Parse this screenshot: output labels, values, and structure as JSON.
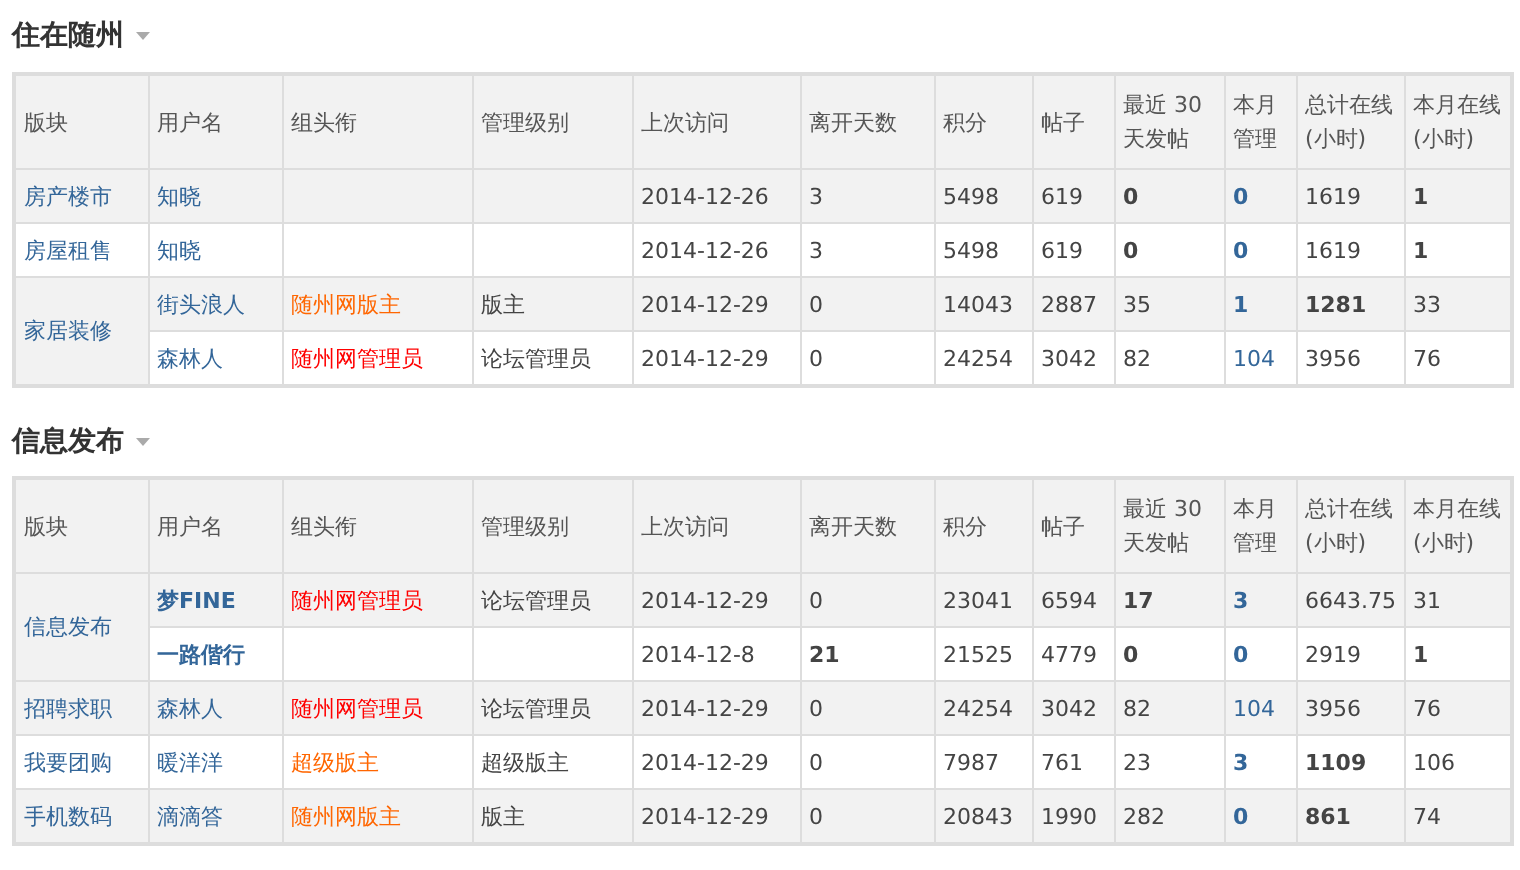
{
  "sections": [
    {
      "title": "住在随州",
      "columns": [
        "版块",
        "用户名",
        "组头衔",
        "管理级别",
        "上次访问",
        "离开天数",
        "积分",
        "帖子",
        "最近 30 天发帖",
        "本月管理",
        "总计在线(小时)",
        "本月在线(小时)"
      ],
      "groups": [
        {
          "board": "房产楼市",
          "rows": [
            {
              "cells": [
                {
                  "kind": "link",
                  "text": "知晓",
                  "bold": false
                },
                {
                  "kind": "empty"
                },
                {
                  "kind": "empty"
                },
                {
                  "kind": "text",
                  "text": "2014-12-26",
                  "bold": false
                },
                {
                  "kind": "text",
                  "text": "3",
                  "bold": false
                },
                {
                  "kind": "text",
                  "text": "5498",
                  "bold": false
                },
                {
                  "kind": "text",
                  "text": "619",
                  "bold": false
                },
                {
                  "kind": "text",
                  "text": "0",
                  "bold": true
                },
                {
                  "kind": "link",
                  "text": "0",
                  "bold": true
                },
                {
                  "kind": "text",
                  "text": "1619",
                  "bold": false
                },
                {
                  "kind": "text",
                  "text": "1",
                  "bold": true
                }
              ]
            }
          ]
        },
        {
          "board": "房屋租售",
          "rows": [
            {
              "cells": [
                {
                  "kind": "link",
                  "text": "知晓",
                  "bold": false
                },
                {
                  "kind": "empty"
                },
                {
                  "kind": "empty"
                },
                {
                  "kind": "text",
                  "text": "2014-12-26",
                  "bold": false
                },
                {
                  "kind": "text",
                  "text": "3",
                  "bold": false
                },
                {
                  "kind": "text",
                  "text": "5498",
                  "bold": false
                },
                {
                  "kind": "text",
                  "text": "619",
                  "bold": false
                },
                {
                  "kind": "text",
                  "text": "0",
                  "bold": true
                },
                {
                  "kind": "link",
                  "text": "0",
                  "bold": true
                },
                {
                  "kind": "text",
                  "text": "1619",
                  "bold": false
                },
                {
                  "kind": "text",
                  "text": "1",
                  "bold": true
                }
              ]
            }
          ]
        },
        {
          "board": "家居装修",
          "rows": [
            {
              "cells": [
                {
                  "kind": "link",
                  "text": "街头浪人",
                  "bold": false
                },
                {
                  "kind": "title",
                  "text": "随州网版主",
                  "color": "#ff6600",
                  "bold": false
                },
                {
                  "kind": "text",
                  "text": "版主",
                  "bold": false
                },
                {
                  "kind": "text",
                  "text": "2014-12-29",
                  "bold": false
                },
                {
                  "kind": "text",
                  "text": "0",
                  "bold": false
                },
                {
                  "kind": "text",
                  "text": "14043",
                  "bold": false
                },
                {
                  "kind": "text",
                  "text": "2887",
                  "bold": false
                },
                {
                  "kind": "text",
                  "text": "35",
                  "bold": false
                },
                {
                  "kind": "link",
                  "text": "1",
                  "bold": true
                },
                {
                  "kind": "text",
                  "text": "1281",
                  "bold": true
                },
                {
                  "kind": "text",
                  "text": "33",
                  "bold": false
                }
              ]
            },
            {
              "cells": [
                {
                  "kind": "link",
                  "text": "森林人",
                  "bold": false
                },
                {
                  "kind": "title",
                  "text": "随州网管理员",
                  "color": "#ff0000",
                  "bold": false
                },
                {
                  "kind": "text",
                  "text": "论坛管理员",
                  "bold": false
                },
                {
                  "kind": "text",
                  "text": "2014-12-29",
                  "bold": false
                },
                {
                  "kind": "text",
                  "text": "0",
                  "bold": false
                },
                {
                  "kind": "text",
                  "text": "24254",
                  "bold": false
                },
                {
                  "kind": "text",
                  "text": "3042",
                  "bold": false
                },
                {
                  "kind": "text",
                  "text": "82",
                  "bold": false
                },
                {
                  "kind": "link",
                  "text": "104",
                  "bold": false
                },
                {
                  "kind": "text",
                  "text": "3956",
                  "bold": false
                },
                {
                  "kind": "text",
                  "text": "76",
                  "bold": false
                }
              ]
            }
          ]
        }
      ]
    },
    {
      "title": "信息发布",
      "columns": [
        "版块",
        "用户名",
        "组头衔",
        "管理级别",
        "上次访问",
        "离开天数",
        "积分",
        "帖子",
        "最近 30 天发帖",
        "本月管理",
        "总计在线(小时)",
        "本月在线(小时)"
      ],
      "groups": [
        {
          "board": "信息发布",
          "rows": [
            {
              "cells": [
                {
                  "kind": "link",
                  "text": "梦FINE",
                  "bold": true
                },
                {
                  "kind": "title",
                  "text": "随州网管理员",
                  "color": "#ff0000",
                  "bold": false
                },
                {
                  "kind": "text",
                  "text": "论坛管理员",
                  "bold": false
                },
                {
                  "kind": "text",
                  "text": "2014-12-29",
                  "bold": false
                },
                {
                  "kind": "text",
                  "text": "0",
                  "bold": false
                },
                {
                  "kind": "text",
                  "text": "23041",
                  "bold": false
                },
                {
                  "kind": "text",
                  "text": "6594",
                  "bold": false
                },
                {
                  "kind": "text",
                  "text": "17",
                  "bold": true
                },
                {
                  "kind": "link",
                  "text": "3",
                  "bold": true
                },
                {
                  "kind": "text",
                  "text": "6643.75",
                  "bold": false
                },
                {
                  "kind": "text",
                  "text": "31",
                  "bold": false
                }
              ]
            },
            {
              "cells": [
                {
                  "kind": "link",
                  "text": "一路偕行",
                  "bold": true
                },
                {
                  "kind": "empty"
                },
                {
                  "kind": "empty"
                },
                {
                  "kind": "text",
                  "text": "2014-12-8",
                  "bold": false
                },
                {
                  "kind": "text",
                  "text": "21",
                  "bold": true
                },
                {
                  "kind": "text",
                  "text": "21525",
                  "bold": false
                },
                {
                  "kind": "text",
                  "text": "4779",
                  "bold": false
                },
                {
                  "kind": "text",
                  "text": "0",
                  "bold": true
                },
                {
                  "kind": "link",
                  "text": "0",
                  "bold": true
                },
                {
                  "kind": "text",
                  "text": "2919",
                  "bold": false
                },
                {
                  "kind": "text",
                  "text": "1",
                  "bold": true
                }
              ]
            }
          ]
        },
        {
          "board": "招聘求职",
          "rows": [
            {
              "cells": [
                {
                  "kind": "link",
                  "text": "森林人",
                  "bold": false
                },
                {
                  "kind": "title",
                  "text": "随州网管理员",
                  "color": "#ff0000",
                  "bold": false
                },
                {
                  "kind": "text",
                  "text": "论坛管理员",
                  "bold": false
                },
                {
                  "kind": "text",
                  "text": "2014-12-29",
                  "bold": false
                },
                {
                  "kind": "text",
                  "text": "0",
                  "bold": false
                },
                {
                  "kind": "text",
                  "text": "24254",
                  "bold": false
                },
                {
                  "kind": "text",
                  "text": "3042",
                  "bold": false
                },
                {
                  "kind": "text",
                  "text": "82",
                  "bold": false
                },
                {
                  "kind": "link",
                  "text": "104",
                  "bold": false
                },
                {
                  "kind": "text",
                  "text": "3956",
                  "bold": false
                },
                {
                  "kind": "text",
                  "text": "76",
                  "bold": false
                }
              ]
            }
          ]
        },
        {
          "board": "我要团购",
          "rows": [
            {
              "cells": [
                {
                  "kind": "link",
                  "text": "暖洋洋",
                  "bold": false
                },
                {
                  "kind": "title",
                  "text": "超级版主",
                  "color": "#ff6600",
                  "bold": false
                },
                {
                  "kind": "text",
                  "text": "超级版主",
                  "bold": false
                },
                {
                  "kind": "text",
                  "text": "2014-12-29",
                  "bold": false
                },
                {
                  "kind": "text",
                  "text": "0",
                  "bold": false
                },
                {
                  "kind": "text",
                  "text": "7987",
                  "bold": false
                },
                {
                  "kind": "text",
                  "text": "761",
                  "bold": false
                },
                {
                  "kind": "text",
                  "text": "23",
                  "bold": false
                },
                {
                  "kind": "link",
                  "text": "3",
                  "bold": true
                },
                {
                  "kind": "text",
                  "text": "1109",
                  "bold": true
                },
                {
                  "kind": "text",
                  "text": "106",
                  "bold": false
                }
              ]
            }
          ]
        },
        {
          "board": "手机数码",
          "rows": [
            {
              "cells": [
                {
                  "kind": "link",
                  "text": "滴滴答",
                  "bold": false
                },
                {
                  "kind": "title",
                  "text": "随州网版主",
                  "color": "#ff6600",
                  "bold": false
                },
                {
                  "kind": "text",
                  "text": "版主",
                  "bold": false
                },
                {
                  "kind": "text",
                  "text": "2014-12-29",
                  "bold": false
                },
                {
                  "kind": "text",
                  "text": "0",
                  "bold": false
                },
                {
                  "kind": "text",
                  "text": "20843",
                  "bold": false
                },
                {
                  "kind": "text",
                  "text": "1990",
                  "bold": false
                },
                {
                  "kind": "text",
                  "text": "282",
                  "bold": false
                },
                {
                  "kind": "link",
                  "text": "0",
                  "bold": true
                },
                {
                  "kind": "text",
                  "text": "861",
                  "bold": true
                },
                {
                  "kind": "text",
                  "text": "74",
                  "bold": false
                }
              ]
            }
          ]
        }
      ]
    }
  ]
}
